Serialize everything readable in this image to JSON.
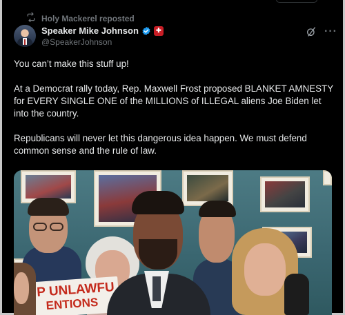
{
  "repost": {
    "icon": "repost-icon",
    "text": "Holy Mackerel reposted"
  },
  "author": {
    "display_name": "Speaker Mike Johnson",
    "handle": "@SpeakerJohnson",
    "verified_icon": "verified-badge-icon",
    "affiliation_icon": "government-badge-icon",
    "affiliation_glyph": "✚"
  },
  "actions": {
    "grok_icon": "grok-icon",
    "more_icon": "more-icon",
    "more_glyph": "···"
  },
  "tweet": {
    "paragraphs": [
      "You can’t make this stuff up!",
      "At a Democrat rally today, Rep. Maxwell Frost proposed BLANKET AMNESTY for EVERY SINGLE ONE of the MILLIONS of ILLEGAL aliens Joe Biden let into the country.",
      "Republicans will never let this dangerous idea happen. We must defend common sense and the rule of law."
    ]
  },
  "media": {
    "sign_line1": "P UNLAWFU",
    "sign_line2": "ENTIONS"
  },
  "colors": {
    "background": "#000000",
    "text": "#e7e9ea",
    "secondary": "#71767b",
    "verified": "#1d9bf0",
    "badge": "#c81d25"
  }
}
